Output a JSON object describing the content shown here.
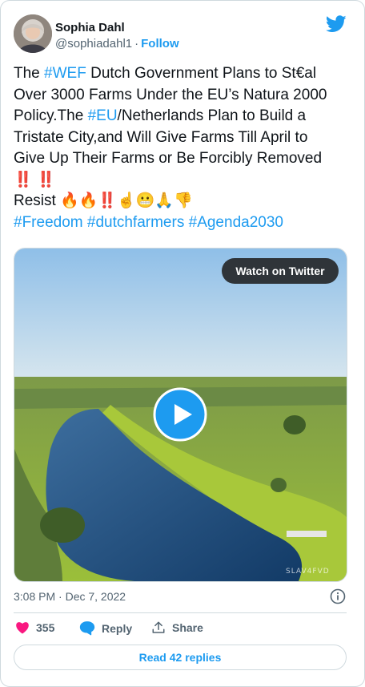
{
  "author": {
    "name": "Sophia Dahl",
    "handle": "@sophiadahl1",
    "separator": "·",
    "follow_label": "Follow"
  },
  "tweet": {
    "lines": [
      [
        {
          "t": "The ",
          "tag": false
        },
        {
          "t": "#WEF",
          "tag": true
        },
        {
          "t": " Dutch Government Plans to St€al",
          "tag": false
        }
      ],
      [
        {
          "t": "Over 3000 Farms Under the EU’s Natura 2000",
          "tag": false
        }
      ],
      [
        {
          "t": "Policy.The ",
          "tag": false
        },
        {
          "t": "#EU",
          "tag": true
        },
        {
          "t": "/Netherlands Plan to Build a",
          "tag": false
        }
      ],
      [
        {
          "t": "Tristate City,and Will Give Farms Till April to",
          "tag": false
        }
      ],
      [
        {
          "t": "Give Up Their Farms or Be Forcibly Removed",
          "tag": false
        }
      ],
      [
        {
          "t": "‼️ ‼️",
          "tag": false
        }
      ],
      [
        {
          "t": " ",
          "tag": false
        }
      ],
      [
        {
          "t": "Resist 🔥🔥‼️☝️😬🙏👎",
          "tag": false
        }
      ],
      [
        {
          "t": "#Freedom",
          "tag": true
        },
        {
          "t": " ",
          "tag": false
        },
        {
          "t": "#dutchfarmers",
          "tag": true
        },
        {
          "t": " ",
          "tag": false
        },
        {
          "t": "#Agenda2030",
          "tag": true
        }
      ]
    ]
  },
  "media": {
    "watch_label": "Watch on Twitter",
    "watermark": "SLAV4FVD"
  },
  "timestamp": "3:08 PM · Dec 7, 2022",
  "actions": {
    "likes": "355",
    "reply_label": "Reply",
    "share_label": "Share"
  },
  "read_replies_label": "Read 42 replies",
  "colors": {
    "accent": "#1d9bf0",
    "like": "#f91880",
    "text": "#0f1419",
    "muted": "#536471"
  }
}
